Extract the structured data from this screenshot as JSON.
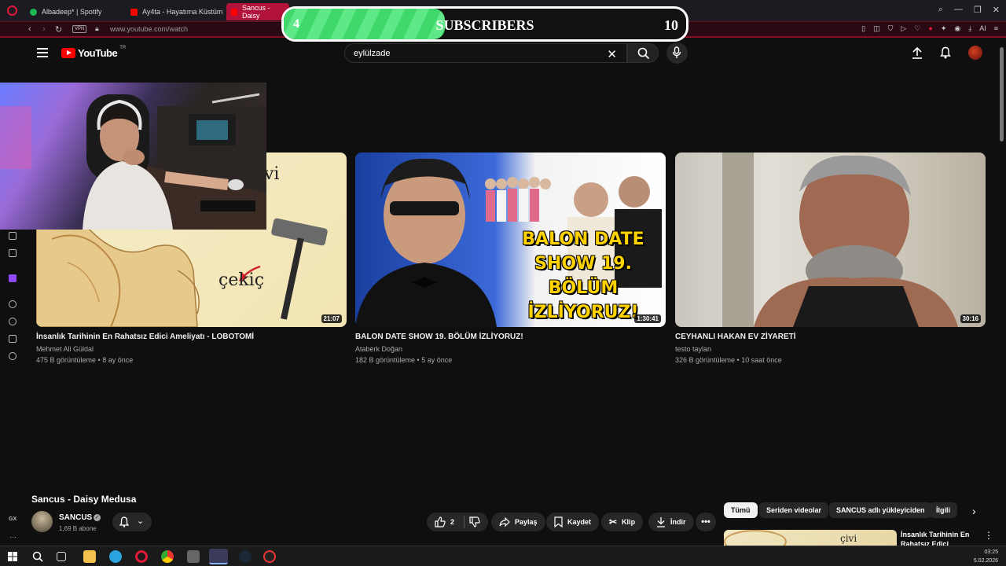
{
  "browser": {
    "tabs": [
      {
        "label": "Albadeep* | Spotify"
      },
      {
        "label": "Ay4ta - Hayatıma Küstüm"
      },
      {
        "label": "Sancus - Daisy"
      }
    ],
    "vpn_label": "VPN",
    "url": "www.youtube.com/watch",
    "ai_label": "AI"
  },
  "overlay": {
    "current": "4",
    "label": "SUBSCRIBERS",
    "goal": "10",
    "progress_fraction": 0.4
  },
  "youtube": {
    "logo_text": "YouTube",
    "region": "TR",
    "search_value": "eylülzade"
  },
  "videos": [
    {
      "title": "İnsanlık Tarihinin En Rahatsız Edici Ameliyatı - LOBOTOMİ",
      "channel": "Mehmet Ali Güldal",
      "meta": "475 B görüntüleme • 8 ay önce",
      "duration": "21:07",
      "thumb_text_1": "çekiç",
      "thumb_text_2": "vi"
    },
    {
      "title": "BALON DATE SHOW 19. BÖLÜM İZLİYORUZ!",
      "channel": "Ataberk Doğan",
      "meta": "182 B görüntüleme • 5 ay önce",
      "duration": "1:30:41",
      "thumb_lines": [
        "BALON DATE",
        "SHOW 19.",
        "BÖLÜM",
        "İZLİYORUZ!"
      ]
    },
    {
      "title": "CEYHANLI HAKAN EV ZİYARETİ",
      "channel": "testo taylan",
      "meta": "326 B görüntüleme • 10 saat önce",
      "duration": "30:16"
    }
  ],
  "player": {
    "title": "Sancus - Daisy Medusa",
    "channel_name": "SANCUS",
    "subscribers": "1,69 B abone",
    "like_count": "2",
    "share_label": "Paylaş",
    "save_label": "Kaydet",
    "clip_label": "Klip",
    "download_label": "İndir"
  },
  "chips": [
    "Tümü",
    "Seriden videolar",
    "SANCUS adlı yükleyiciden",
    "İlgili"
  ],
  "side_video": {
    "title": "İnsanlık Tarihinin En Rahatsız Edici",
    "thumb_text": "çivi"
  },
  "rail": {
    "gx_label": "GX"
  },
  "taskbar": {
    "time": "03:25",
    "date": "5.02.2026"
  }
}
